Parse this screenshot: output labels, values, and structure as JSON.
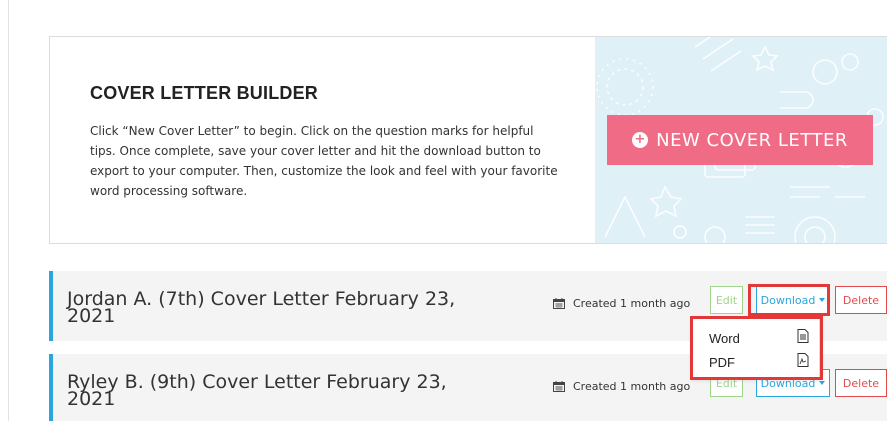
{
  "hero": {
    "title": "COVER LETTER BUILDER",
    "description": "Click “New Cover Letter” to begin. Click on the question marks for helpful tips. Once complete, save your cover letter and hit the download button to export to your computer. Then, customize the look and feel with your favorite word processing software.",
    "new_button_label": "NEW COVER LETTER",
    "art_color": "#dff0f7",
    "button_color": "#f06b85"
  },
  "letters": [
    {
      "title": "Jordan A. (7th) Cover Letter February 23, 2021",
      "created": "Created 1 month ago",
      "edit_label": "Edit",
      "download_label": "Download",
      "delete_label": "Delete"
    },
    {
      "title": "Ryley B. (9th) Cover Letter February 23, 2021",
      "created": "Created 1 month ago",
      "edit_label": "Edit",
      "download_label": "Download",
      "delete_label": "Delete"
    }
  ],
  "download_menu": {
    "items": [
      {
        "label": "Word",
        "icon": "word-document-icon"
      },
      {
        "label": "PDF",
        "icon": "pdf-document-icon"
      }
    ]
  },
  "colors": {
    "accent": "#29a6de",
    "edit": "#9fd58a",
    "delete": "#e24b4b",
    "highlight": "#e23838"
  }
}
